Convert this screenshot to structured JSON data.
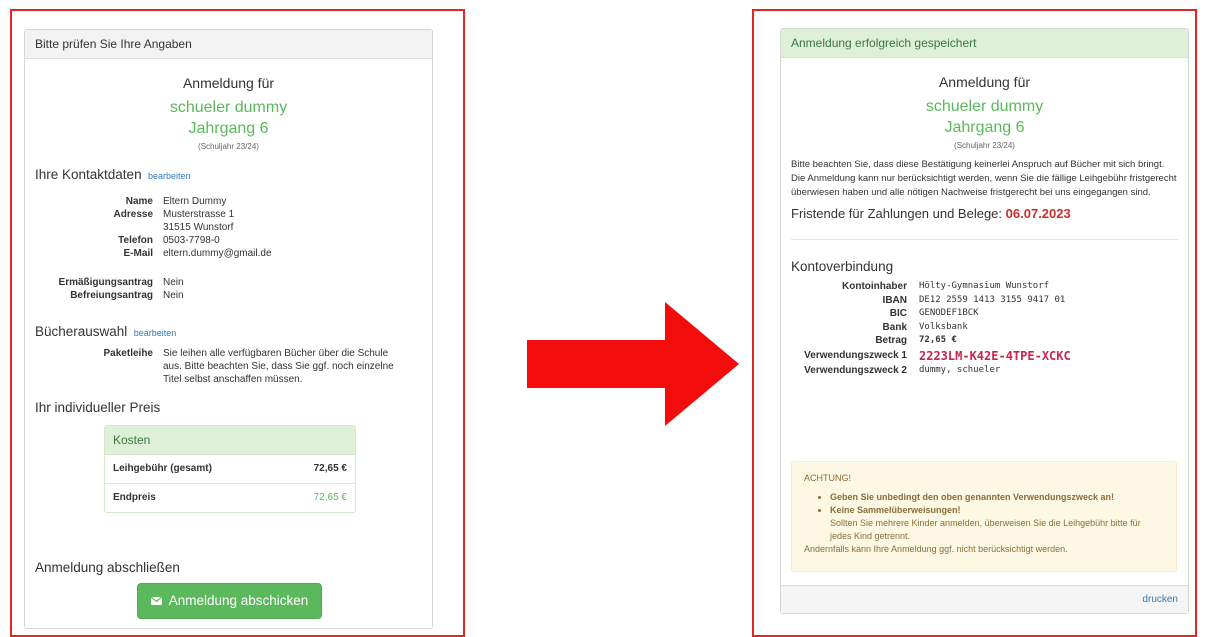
{
  "left": {
    "heading": "Bitte prüfen Sie Ihre Angaben",
    "anmeldung_fuer": "Anmeldung für",
    "student_name": "schueler dummy",
    "jahrgang": "Jahrgang 6",
    "schuljahr": "(Schuljahr 23/24)",
    "contact": {
      "title": "Ihre Kontaktdaten",
      "edit": "bearbeiten",
      "name_label": "Name",
      "name_value": "Eltern Dummy",
      "address_label": "Adresse",
      "address_line1": "Musterstrasse 1",
      "address_line2": "31515 Wunstorf",
      "phone_label": "Telefon",
      "phone_value": "0503-7798-0",
      "email_label": "E-Mail",
      "email_value": "eltern.dummy@gmail.de",
      "reduction_label": "Ermäßigungsantrag",
      "reduction_value": "Nein",
      "exemption_label": "Befreiungsantrag",
      "exemption_value": "Nein"
    },
    "books": {
      "title": "Bücherauswahl",
      "edit": "bearbeiten",
      "package_label": "Paketleihe",
      "package_text": "Sie leihen alle verfügbaren Bücher über die Schule aus. Bitte beachten Sie, dass Sie ggf. noch einzelne Titel selbst anschaffen müssen."
    },
    "price": {
      "title": "Ihr individueller Preis",
      "costs_header": "Kosten",
      "fee_label": "Leihgebühr (gesamt)",
      "fee_value": "72,65 €",
      "total_label": "Endpreis",
      "total_value": "72,65 €"
    },
    "finish": {
      "title": "Anmeldung abschließen",
      "button": "Anmeldung abschicken"
    }
  },
  "right": {
    "heading": "Anmeldung erfolgreich gespeichert",
    "anmeldung_fuer": "Anmeldung für",
    "student_name": "schueler dummy",
    "jahrgang": "Jahrgang 6",
    "schuljahr": "(Schuljahr 23/24)",
    "notice": "Bitte beachten Sie, dass diese Bestätigung keinerlei Anspruch auf Bücher mit sich bringt. Die Anmeldung kann nur berücksichtigt werden, wenn Sie die fällige Leihgebühr fristgerecht überwiesen haben und alle nötigen Nachweise fristgerecht bei uns eingegangen sind.",
    "deadline_label": "Fristende für Zahlungen und Belege:",
    "deadline_date": "06.07.2023",
    "bank": {
      "title": "Kontoverbindung",
      "holder_label": "Kontoinhaber",
      "holder_value": "Hölty-Gymnasium Wunstorf",
      "iban_label": "IBAN",
      "iban_value": "DE12 2559 1413 3155 9417 01",
      "bic_label": "BIC",
      "bic_value": "GENODEF1BCK",
      "bankname_label": "Bank",
      "bankname_value": "Volksbank",
      "amount_label": "Betrag",
      "amount_value": "72,65 €",
      "purpose1_label": "Verwendungszweck 1",
      "purpose1_value": "2223LM-K42E-4TPE-XCKC",
      "purpose2_label": "Verwendungszweck 2",
      "purpose2_value": "dummy, schueler"
    },
    "warning": {
      "title": "ACHTUNG!",
      "item1": "Geben Sie unbedingt den oben genannten Verwendungszweck an!",
      "item2": "Keine Sammelüberweisungen!",
      "item2_sub": "Sollten Sie mehrere Kinder anmelden, überweisen Sie die Leihgebühr bitte für jedes Kind getrennt.",
      "footer": "Andernfalls kann Ihre Anmeldung ggf. nicht berücksichtigt werden."
    },
    "print": "drucken"
  },
  "colors": {
    "frame": "#e52521",
    "green": "#5cb85c",
    "link": "#337ab7",
    "deadline": "#c9302c",
    "purpose": "#c7254e"
  }
}
